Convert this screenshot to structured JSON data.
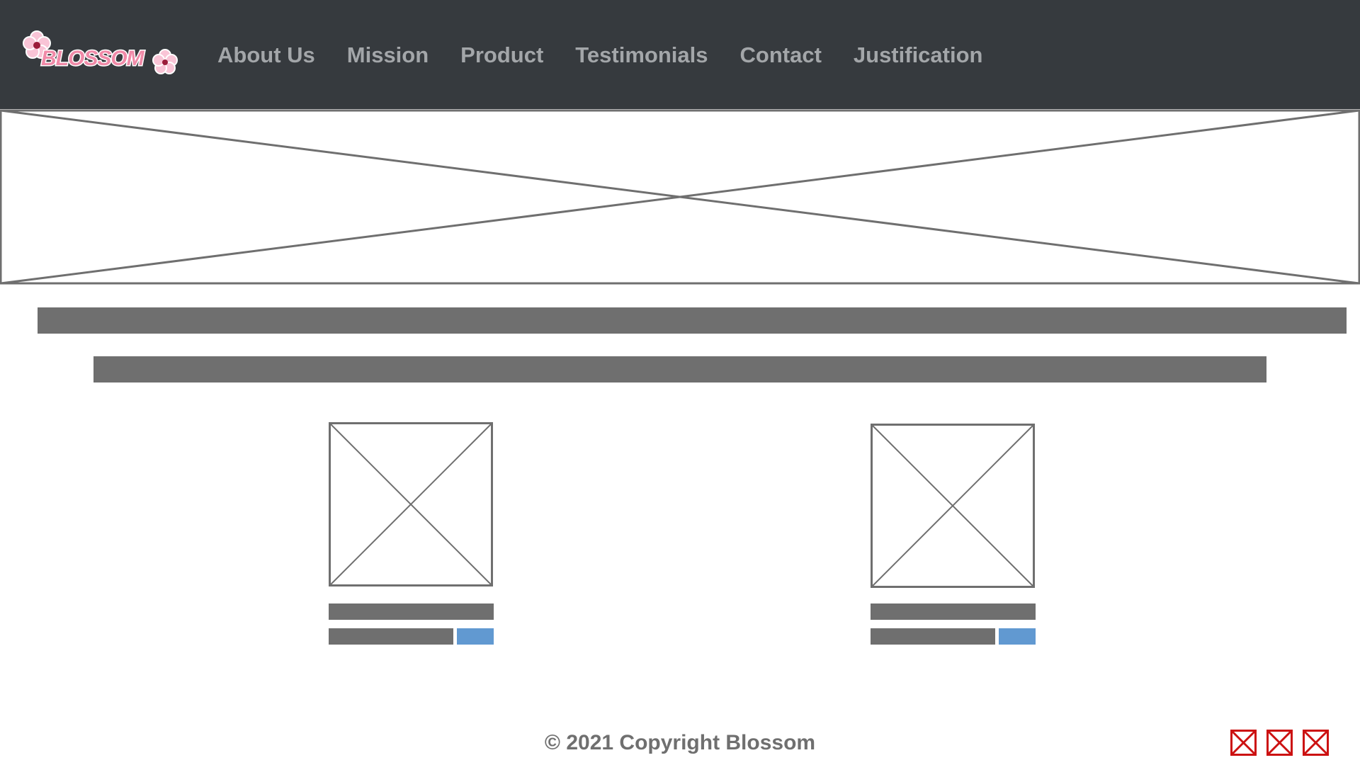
{
  "brand": {
    "logo_text": "BLOSSOM",
    "colors": {
      "navbar_bg": "#363a3e",
      "nav_text": "#a3a6a9",
      "placeholder_bar": "#6f6f6f",
      "accent_button": "#6199d1",
      "social_icon": "#cc1111",
      "logo_pink": "#f08aa8"
    }
  },
  "nav": {
    "items": [
      {
        "label": "About Us"
      },
      {
        "label": "Mission"
      },
      {
        "label": "Product"
      },
      {
        "label": "Testimonials"
      },
      {
        "label": "Contact"
      },
      {
        "label": "Justification"
      }
    ]
  },
  "hero": {
    "icon": "image-placeholder-icon"
  },
  "products": [
    {
      "image_icon": "image-placeholder-icon",
      "button_icon": "buy-button"
    },
    {
      "image_icon": "image-placeholder-icon",
      "button_icon": "buy-button"
    }
  ],
  "footer": {
    "copyright": "© 2021 Copyright Blossom",
    "social_icons": [
      "social-link-icon",
      "social-link-icon",
      "social-link-icon"
    ]
  }
}
